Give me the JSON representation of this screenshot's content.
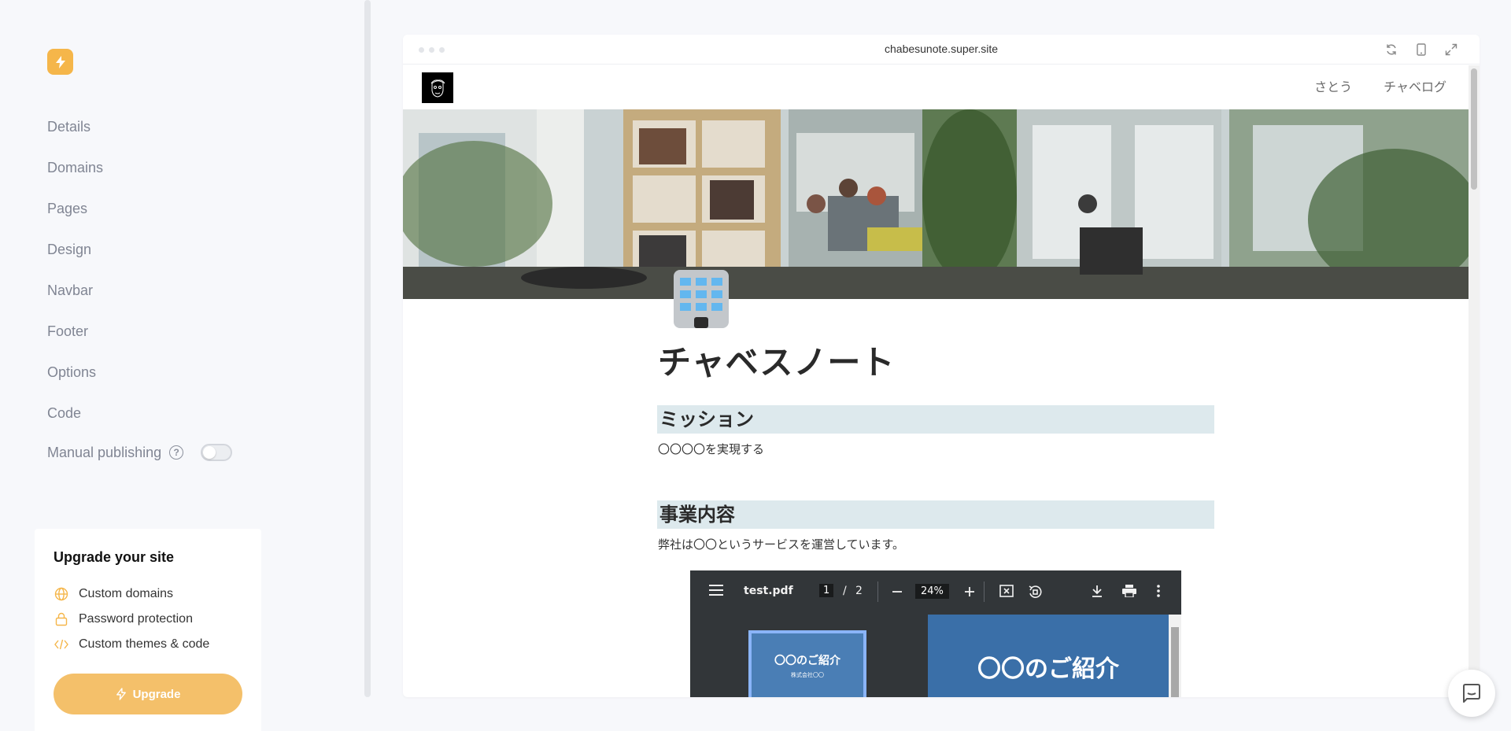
{
  "sidebar": {
    "nav": [
      {
        "label": "Details"
      },
      {
        "label": "Domains"
      },
      {
        "label": "Pages"
      },
      {
        "label": "Design"
      },
      {
        "label": "Navbar"
      },
      {
        "label": "Footer"
      },
      {
        "label": "Options"
      },
      {
        "label": "Code"
      }
    ],
    "manual_publishing": {
      "label": "Manual publishing",
      "help": "?",
      "enabled": false
    }
  },
  "upgrade": {
    "title": "Upgrade your site",
    "features": [
      {
        "icon": "globe-icon",
        "label": "Custom domains"
      },
      {
        "icon": "lock-icon",
        "label": "Password protection"
      },
      {
        "icon": "code-icon",
        "label": "Custom themes & code"
      }
    ],
    "button": "Upgrade"
  },
  "preview": {
    "url": "chabesunote.super.site",
    "site": {
      "nav": [
        "さとう",
        "チャベログ"
      ],
      "title": "チャベスノート",
      "sections": [
        {
          "heading": "ミッション",
          "text": "〇〇〇〇を実現する"
        },
        {
          "heading": "事業内容",
          "text": "弊社は〇〇というサービスを運営しています。"
        }
      ],
      "pdf": {
        "filename": "test.pdf",
        "page": "1",
        "separator": "/",
        "total": "2",
        "zoom": "24%",
        "thumb_title": "〇〇のご紹介",
        "thumb_sub": "株式会社〇〇",
        "page_title": "〇〇のご紹介"
      }
    }
  },
  "colors": {
    "accent": "#f5b64a",
    "heading_bg": "#dde9ed"
  }
}
